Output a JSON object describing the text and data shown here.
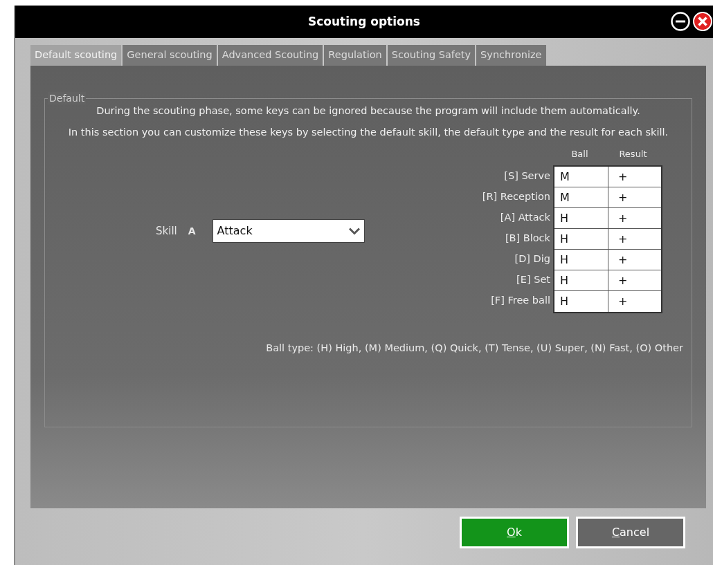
{
  "window": {
    "title": "Scouting options"
  },
  "tabs": [
    {
      "label": "Default scouting",
      "selected": true
    },
    {
      "label": "General scouting",
      "selected": false
    },
    {
      "label": "Advanced Scouting",
      "selected": false
    },
    {
      "label": "Regulation",
      "selected": false
    },
    {
      "label": "Scouting Safety",
      "selected": false
    },
    {
      "label": "Synchronize",
      "selected": false
    }
  ],
  "group": {
    "legend": "Default",
    "intro": [
      "During the scouting phase, some keys can be ignored because the program will include them automatically.",
      "In this section you can customize these keys by selecting the default skill, the default type and the result for each skill."
    ],
    "skill": {
      "label": "Skill",
      "key": "A",
      "value": "Attack"
    },
    "table": {
      "columns": [
        "Ball",
        "Result"
      ],
      "rows": [
        {
          "label": "[S] Serve",
          "ball": "M",
          "result": "+"
        },
        {
          "label": "[R] Reception",
          "ball": "M",
          "result": "+"
        },
        {
          "label": "[A] Attack",
          "ball": "H",
          "result": "+"
        },
        {
          "label": "[B] Block",
          "ball": "H",
          "result": "+"
        },
        {
          "label": "[D] Dig",
          "ball": "H",
          "result": "+"
        },
        {
          "label": "[E] Set",
          "ball": "H",
          "result": "+"
        },
        {
          "label": "[F] Free ball",
          "ball": "H",
          "result": "+"
        }
      ]
    },
    "legend_note": "Ball type: (H) High, (M) Medium, (Q) Quick, (T) Tense, (U) Super, (N) Fast, (O) Other"
  },
  "buttons": [
    {
      "label": "Ok",
      "kind": "primary"
    },
    {
      "label": "Cancel",
      "kind": "secondary"
    }
  ]
}
